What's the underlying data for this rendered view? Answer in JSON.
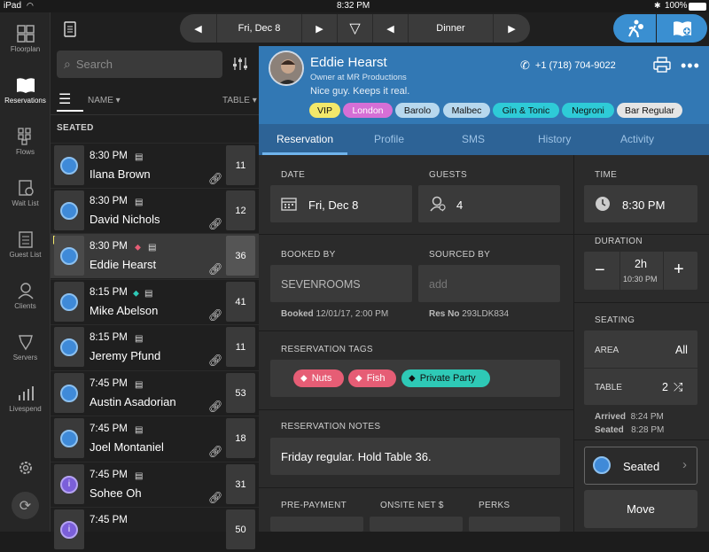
{
  "status_bar": {
    "device": "iPad",
    "time": "8:32 PM",
    "battery": "100%"
  },
  "rail": [
    {
      "label": "Floorplan",
      "icon": "floorplan-icon"
    },
    {
      "label": "Reservations",
      "icon": "book-icon"
    },
    {
      "label": "Flows",
      "icon": "flows-icon"
    },
    {
      "label": "Wait List",
      "icon": "waitlist-icon"
    },
    {
      "label": "Guest List",
      "icon": "guestlist-icon"
    },
    {
      "label": "Clients",
      "icon": "clients-icon"
    },
    {
      "label": "Servers",
      "icon": "servers-icon"
    },
    {
      "label": "Livespend",
      "icon": "livespend-icon"
    }
  ],
  "topbar": {
    "date": "Fri, Dec 8",
    "shift": "Dinner"
  },
  "search": {
    "placeholder": "Search"
  },
  "list": {
    "col_name": "NAME",
    "col_table": "TABLE",
    "section": "SEATED",
    "rows": [
      {
        "time": "8:30 PM",
        "name": "Ilana Brown",
        "table": "11"
      },
      {
        "time": "8:30 PM",
        "name": "David Nichols",
        "table": "12"
      },
      {
        "time": "8:30 PM",
        "name": "Eddie Hearst",
        "table": "36"
      },
      {
        "time": "8:15 PM",
        "name": "Mike Abelson",
        "table": "41"
      },
      {
        "time": "8:15 PM",
        "name": "Jeremy Pfund",
        "table": "11"
      },
      {
        "time": "7:45 PM",
        "name": "Austin Asadorian",
        "table": "53"
      },
      {
        "time": "7:45 PM",
        "name": "Joel Montaniel",
        "table": "18"
      },
      {
        "time": "7:45 PM",
        "name": "Sohee Oh",
        "table": "31"
      },
      {
        "time": "7:45 PM",
        "name": "",
        "table": "50"
      }
    ]
  },
  "guest": {
    "name": "Eddie Hearst",
    "title": "Owner at MR Productions",
    "note": "Nice guy. Keeps it real.",
    "phone": "+1 (718) 704-9022",
    "chips": [
      "VIP",
      "London",
      "Barolo",
      "Malbec",
      "Gin & Tonic",
      "Negroni",
      "Bar Regular"
    ]
  },
  "tabs": [
    "Reservation",
    "Profile",
    "SMS",
    "History",
    "Activity"
  ],
  "res": {
    "date_label": "DATE",
    "date": "Fri, Dec 8",
    "guests_label": "GUESTS",
    "guests": "4",
    "booked_by_label": "BOOKED BY",
    "booked_by": "SEVENROOMS",
    "sourced_by_label": "SOURCED BY",
    "sourced_placeholder": "add",
    "booked_key": "Booked",
    "booked_val": "12/01/17, 2:00 PM",
    "resno_key": "Res No",
    "resno_val": "293LDK834",
    "tags_label": "RESERVATION TAGS",
    "tags": [
      "Nuts",
      "Fish",
      "Private Party"
    ],
    "notes_label": "RESERVATION NOTES",
    "notes": "Friday regular. Hold Table 36.",
    "prepay_label": "PRE-PAYMENT",
    "onsite_label": "ONSITE NET $",
    "perks_label": "PERKS"
  },
  "side": {
    "time_label": "TIME",
    "time": "8:30 PM",
    "duration_label": "DURATION",
    "duration": "2h",
    "duration_end": "10:30 PM",
    "seating_label": "SEATING",
    "area_key": "AREA",
    "area_val": "All",
    "table_key": "TABLE",
    "table_val": "2",
    "arrived_key": "Arrived",
    "arrived_val": "8:24 PM",
    "seated_key": "Seated",
    "seated_val": "8:28 PM",
    "status_btn": "Seated",
    "move_btn": "Move"
  },
  "colors": {
    "accent": "#3a8fd1",
    "header": "#3278b4",
    "tabs": "#2d6396",
    "vip": "#f3e86a",
    "pink": "#e66d87",
    "teal": "#2fc6b4"
  }
}
